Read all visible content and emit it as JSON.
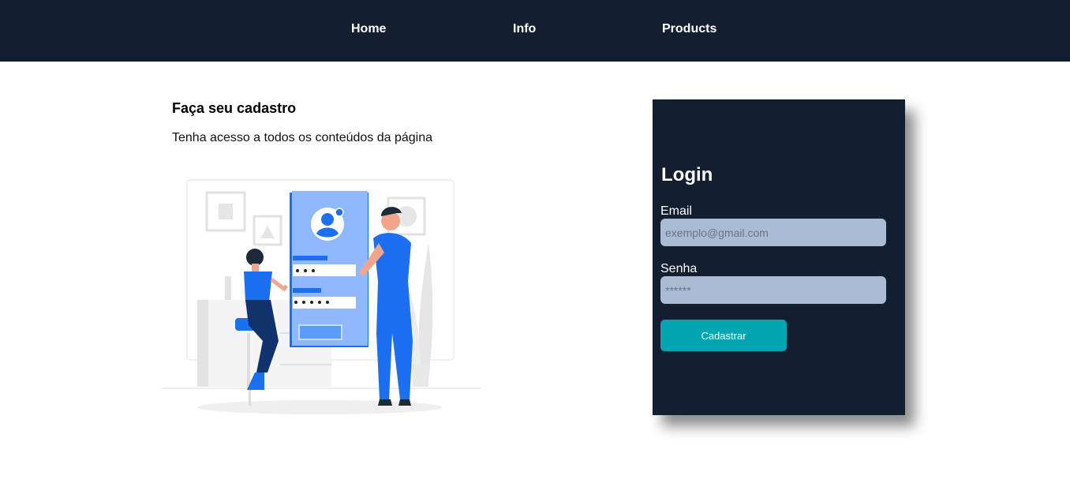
{
  "nav": {
    "home": "Home",
    "info": "Info",
    "products": "Products"
  },
  "intro": {
    "title": "Faça seu cadastro",
    "subtitle": "Tenha acesso a todos os conteúdos da página"
  },
  "login": {
    "title": "Login",
    "email_label": "Email",
    "email_placeholder": "exemplo@gmail.com",
    "password_label": "Senha",
    "password_placeholder": "******",
    "submit_label": "Cadastrar"
  },
  "colors": {
    "navbar": "#131f31",
    "card": "#131f31",
    "input": "#a9bcd3",
    "button": "#00a5b2",
    "illustration_accent": "#1d6ff2"
  }
}
